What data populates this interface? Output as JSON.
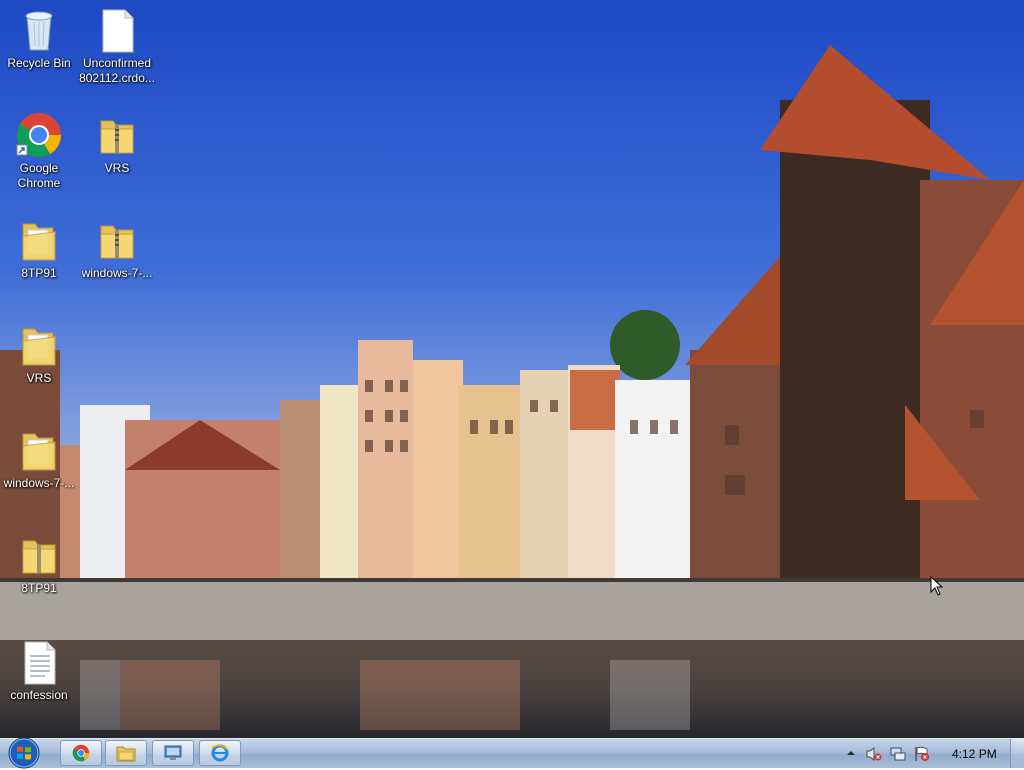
{
  "desktop": {
    "icons": [
      {
        "label": "Recycle Bin",
        "icon": "recycle-bin-icon"
      },
      {
        "label": "Unconfirmed 802112.crdo...",
        "icon": "file-icon"
      },
      {
        "label": "Google Chrome",
        "icon": "chrome-icon"
      },
      {
        "label": "VRS",
        "icon": "zip-folder-icon"
      },
      {
        "label": "8TP91",
        "icon": "folder-icon"
      },
      {
        "label": "windows-7-...",
        "icon": "zip-folder-icon"
      },
      {
        "label": "VRS",
        "icon": "folder-icon"
      },
      {
        "label": "windows-7-...",
        "icon": "folder-icon"
      },
      {
        "label": "8TP91",
        "icon": "zip-folder-icon"
      },
      {
        "label": "confession",
        "icon": "text-file-icon"
      }
    ]
  },
  "taskbar": {
    "pinned": [
      {
        "name": "Google Chrome",
        "icon": "chrome-icon"
      },
      {
        "name": "Windows Explorer",
        "icon": "explorer-icon"
      },
      {
        "name": "Remote Desktop",
        "icon": "remote-desktop-icon"
      },
      {
        "name": "Internet Explorer",
        "icon": "ie-icon"
      }
    ],
    "tray": {
      "icons": [
        "show-hidden-icons-icon",
        "volume-muted-icon",
        "network-icon",
        "action-center-icon"
      ],
      "time": "4:12 PM"
    }
  }
}
